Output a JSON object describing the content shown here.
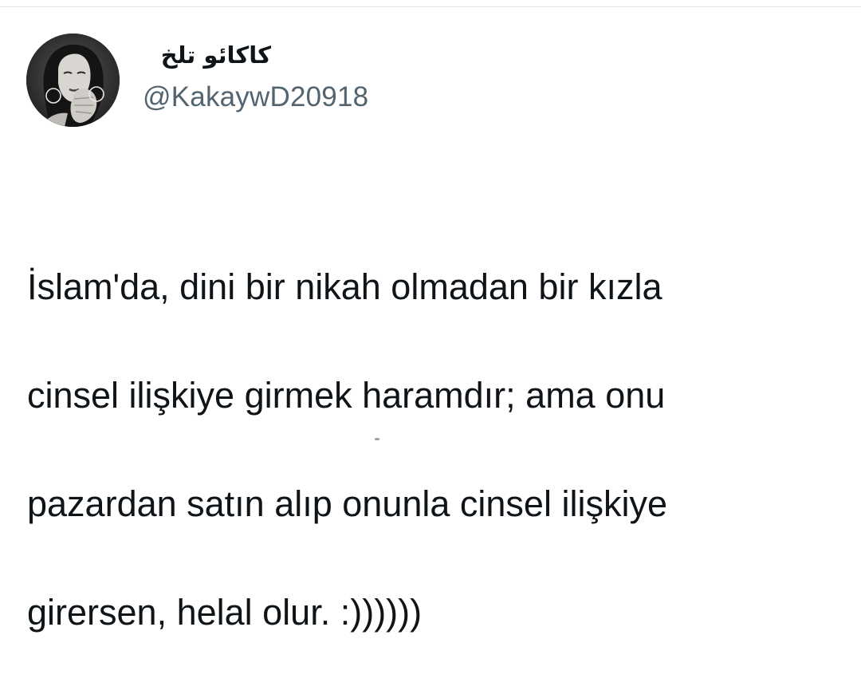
{
  "tweet": {
    "display_name": "کاکائو تلخ",
    "handle": "@KakaywD20918",
    "text_lines": [
      "İslam'da, dini bir nikah olmadan bir kızla",
      "cinsel ilişkiye girmek haramdır; ama onu",
      "pazardan satın alıp onunla cinsel ilişkiye",
      "girersen, helal olur. :))))))"
    ],
    "avatar": {
      "icon": "avatar-photo"
    }
  },
  "colors": {
    "background": "#ffffff",
    "primary_text": "#0f1419",
    "secondary_text": "#536471",
    "divider": "#dde4ea"
  }
}
